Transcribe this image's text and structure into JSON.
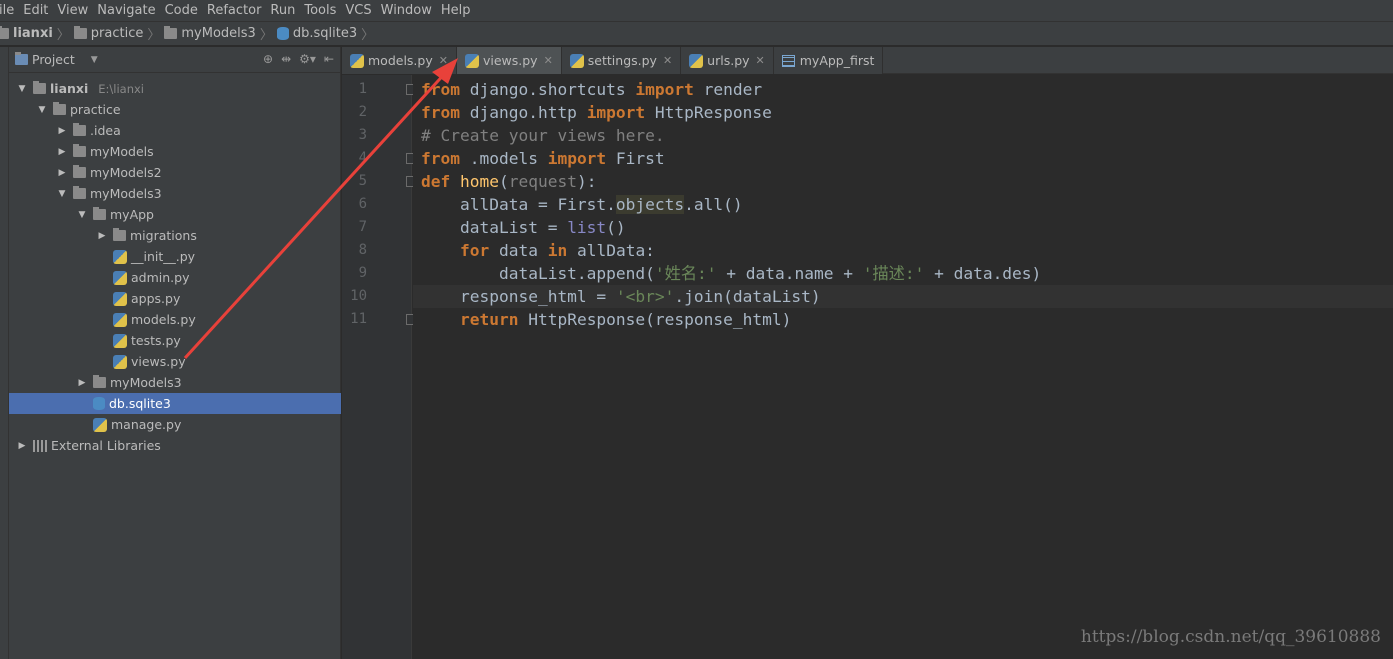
{
  "menu": [
    "ile",
    "Edit",
    "View",
    "Navigate",
    "Code",
    "Refactor",
    "Run",
    "Tools",
    "VCS",
    "Window",
    "Help"
  ],
  "breadcrumb": [
    "lianxi",
    "practice",
    "myModels3",
    "db.sqlite3"
  ],
  "project_panel": {
    "title": "Project"
  },
  "tree": [
    {
      "label": "lianxi",
      "hint": "E:\\lianxi",
      "depth": 0,
      "arrow": "down",
      "icon": "folder"
    },
    {
      "label": "practice",
      "depth": 1,
      "arrow": "down",
      "icon": "folder"
    },
    {
      "label": ".idea",
      "depth": 2,
      "arrow": "right",
      "icon": "folder"
    },
    {
      "label": "myModels",
      "depth": 2,
      "arrow": "right",
      "icon": "folder"
    },
    {
      "label": "myModels2",
      "depth": 2,
      "arrow": "right",
      "icon": "folder"
    },
    {
      "label": "myModels3",
      "depth": 2,
      "arrow": "down",
      "icon": "folder"
    },
    {
      "label": "myApp",
      "depth": 3,
      "arrow": "down",
      "icon": "folder"
    },
    {
      "label": "migrations",
      "depth": 4,
      "arrow": "right",
      "icon": "folder"
    },
    {
      "label": "__init__.py",
      "depth": 4,
      "icon": "py"
    },
    {
      "label": "admin.py",
      "depth": 4,
      "icon": "py"
    },
    {
      "label": "apps.py",
      "depth": 4,
      "icon": "py"
    },
    {
      "label": "models.py",
      "depth": 4,
      "icon": "py"
    },
    {
      "label": "tests.py",
      "depth": 4,
      "icon": "py"
    },
    {
      "label": "views.py",
      "depth": 4,
      "icon": "py"
    },
    {
      "label": "myModels3",
      "depth": 3,
      "arrow": "right",
      "icon": "folder"
    },
    {
      "label": "db.sqlite3",
      "depth": 3,
      "icon": "db",
      "selected": true
    },
    {
      "label": "manage.py",
      "depth": 3,
      "icon": "py"
    },
    {
      "label": "External Libraries",
      "depth": 0,
      "arrow": "right",
      "icon": "lib"
    }
  ],
  "tabs": [
    {
      "label": "models.py",
      "icon": "py"
    },
    {
      "label": "views.py",
      "icon": "py",
      "active": true
    },
    {
      "label": "settings.py",
      "icon": "py"
    },
    {
      "label": "urls.py",
      "icon": "py"
    },
    {
      "label": "myApp_first",
      "icon": "table"
    }
  ],
  "line_numbers": [
    "1",
    "2",
    "3",
    "4",
    "5",
    "6",
    "7",
    "8",
    "9",
    "10",
    "11"
  ],
  "code_lines": [
    "from django.shortcuts import render",
    "from django.http import HttpResponse",
    "# Create your views here.",
    "from .models import First",
    "def home(request):",
    "    allData = First.objects.all()",
    "    dataList = list()",
    "    for data in allData:",
    "        dataList.append('姓名:' + data.name + '描述:' + data.des)",
    "    response_html = '<br>'.join(dataList)",
    "    return HttpResponse(response_html)"
  ],
  "watermark": "https://blog.csdn.net/qq_39610888",
  "colors": {
    "selection": "#4b6eaf",
    "keyword": "#cc7832",
    "string": "#6a8759",
    "annotation_arrow": "#e8413a"
  }
}
